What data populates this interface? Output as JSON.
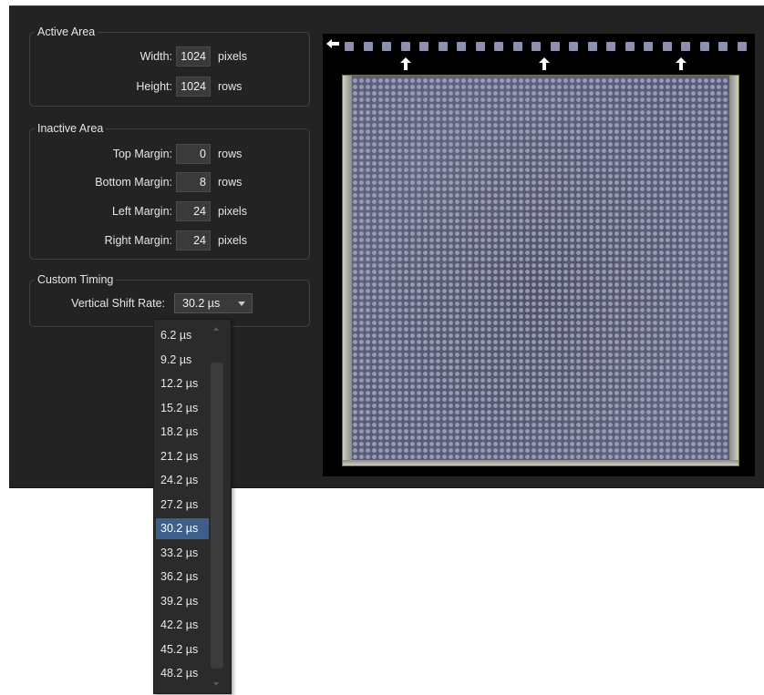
{
  "active_area": {
    "title": "Active Area",
    "fields": [
      {
        "label": "Width:",
        "value": "1024",
        "unit": "pixels"
      },
      {
        "label": "Height:",
        "value": "1024",
        "unit": "rows"
      }
    ]
  },
  "inactive_area": {
    "title": "Inactive Area",
    "fields": [
      {
        "label": "Top Margin:",
        "value": "0",
        "unit": "rows"
      },
      {
        "label": "Bottom Margin:",
        "value": "8",
        "unit": "rows"
      },
      {
        "label": "Left Margin:",
        "value": "24",
        "unit": "pixels"
      },
      {
        "label": "Right Margin:",
        "value": "24",
        "unit": "pixels"
      }
    ]
  },
  "custom_timing": {
    "title": "Custom Timing",
    "label": "Vertical Shift Rate:",
    "selected": "30.2 µs",
    "options": [
      "6.2 µs",
      "9.2 µs",
      "12.2 µs",
      "15.2 µs",
      "18.2 µs",
      "21.2 µs",
      "24.2 µs",
      "27.2 µs",
      "30.2 µs",
      "33.2 µs",
      "36.2 µs",
      "39.2 µs",
      "42.2 µs",
      "45.2 µs",
      "48.2 µs"
    ],
    "selected_index": 8
  },
  "sensor": {
    "serial_register_pixels": 22,
    "vertical_shift_arrows": 3,
    "colors": {
      "pixel": "#8d90b0",
      "arrow": "#ffffff",
      "selection": "#3d5f8a"
    }
  },
  "icons": {
    "readout_arrow": "left-arrow-icon",
    "shift_arrow": "up-arrow-icon",
    "dropdown": "chevron-down-icon"
  }
}
